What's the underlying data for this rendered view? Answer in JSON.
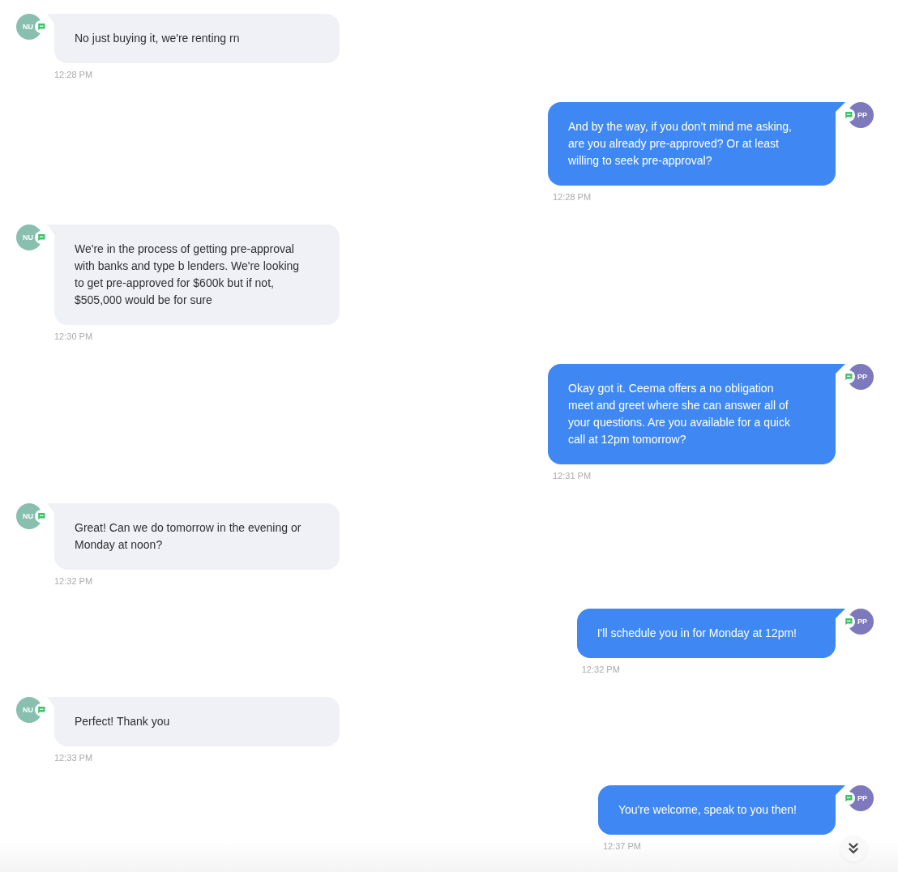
{
  "messages": [
    {
      "kind": "received",
      "avatar": {
        "initials": "NU",
        "color": "#88bfae"
      },
      "text": "No just buying it, we're renting rn",
      "time": "12:28 PM"
    },
    {
      "kind": "sent",
      "avatar": {
        "initials": "PP",
        "color": "#7e78bd"
      },
      "text": "And by the way, if you don’t mind me asking, are you already pre-approved? Or at least willing to seek pre-approval?",
      "time": "12:28 PM"
    },
    {
      "kind": "received",
      "avatar": {
        "initials": "NU",
        "color": "#88bfae"
      },
      "text": "We're in the process of getting pre-approval with banks and type b lenders. We're looking to get pre-approved for $600k but if not, $505,000 would be for sure",
      "time": "12:30 PM"
    },
    {
      "kind": "sent",
      "avatar": {
        "initials": "PP",
        "color": "#7e78bd"
      },
      "text": "Okay got it. Ceema offers a no obligation meet and greet where she can answer all of your questions. Are you available for a quick call at 12pm tomorrow?",
      "time": "12:31 PM"
    },
    {
      "kind": "received",
      "avatar": {
        "initials": "NU",
        "color": "#88bfae"
      },
      "text": "Great! Can we do tomorrow in the evening or Monday at noon?",
      "time": "12:32 PM"
    },
    {
      "kind": "sent",
      "avatar": {
        "initials": "PP",
        "color": "#7e78bd"
      },
      "text": "I'll schedule you in for Monday at 12pm!",
      "time": "12:32 PM"
    },
    {
      "kind": "received",
      "avatar": {
        "initials": "NU",
        "color": "#88bfae"
      },
      "text": "Perfect! Thank you",
      "time": "12:33 PM"
    },
    {
      "kind": "sent",
      "avatar": {
        "initials": "PP",
        "color": "#7e78bd"
      },
      "text": "You're welcome, speak to you then!",
      "time": "12:37 PM"
    }
  ]
}
